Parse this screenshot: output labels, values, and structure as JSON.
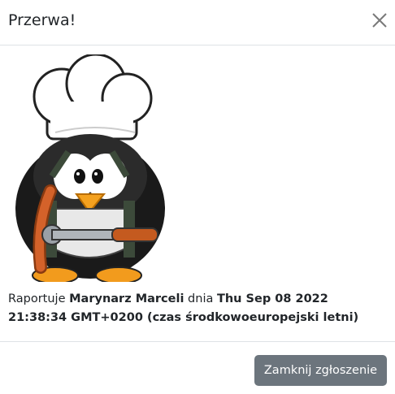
{
  "dialog": {
    "title": "Przerwa!",
    "close_icon": "close-x-icon"
  },
  "body": {
    "illustration": "penguin-chef-with-sausage-and-wrench",
    "report_prefix": "Raportuje ",
    "reporter": "Marynarz Marceli",
    "report_mid": " dnia ",
    "timestamp": "Thu Sep 08 2022 21:38:34 GMT+0200 (czas środkowoeuropejski letni)"
  },
  "footer": {
    "close_report_label": "Zamknij zgłoszenie"
  },
  "colors": {
    "button": "#6c757d",
    "divider": "#dee2e6"
  }
}
